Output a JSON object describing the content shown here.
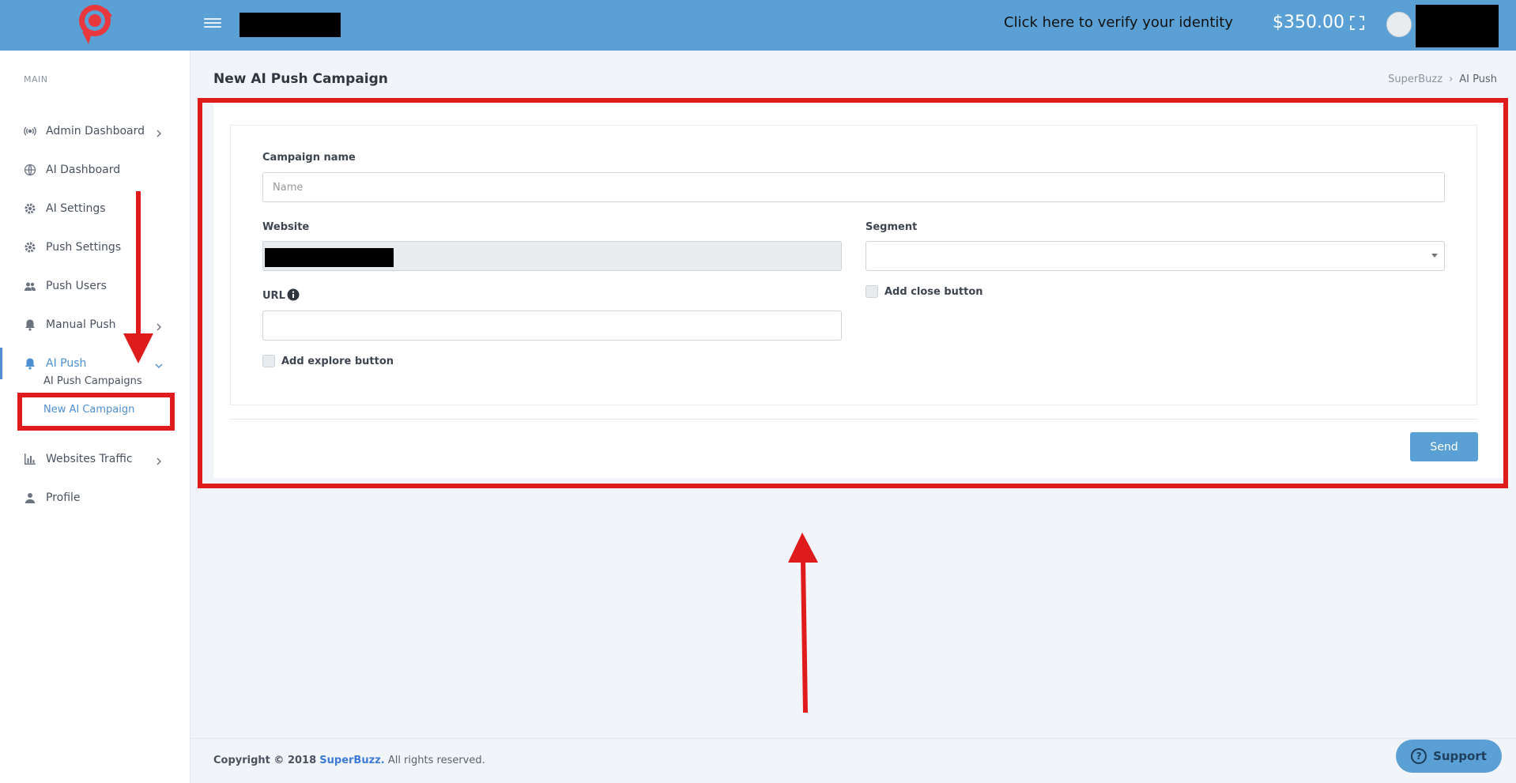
{
  "topbar": {
    "verify_text": "Click here to verify your identity",
    "balance": "$350.00",
    "icons": [
      "logo-icon",
      "hamburger-icon",
      "fullscreen-icon",
      "avatar"
    ]
  },
  "sidebar": {
    "section_title": "MAIN",
    "items": [
      {
        "label": "Admin Dashboard",
        "icon": "broadcast-icon",
        "has_chevron": true
      },
      {
        "label": "AI Dashboard",
        "icon": "globe-icon",
        "has_chevron": false
      },
      {
        "label": "AI Settings",
        "icon": "gear-icon",
        "has_chevron": false
      },
      {
        "label": "Push Settings",
        "icon": "gear-icon",
        "has_chevron": false
      },
      {
        "label": "Push Users",
        "icon": "users-icon",
        "has_chevron": false
      },
      {
        "label": "Manual Push",
        "icon": "bell-icon",
        "has_chevron": true
      },
      {
        "label": "AI Push",
        "icon": "bell-icon",
        "has_chevron": true,
        "active": true
      },
      {
        "label": "Websites Traffic",
        "icon": "bar-chart-icon",
        "has_chevron": true
      },
      {
        "label": "Profile",
        "icon": "user-icon",
        "has_chevron": false
      }
    ],
    "submenu": [
      {
        "label": "AI Push Campaigns"
      },
      {
        "label": "New AI Campaign",
        "current": true
      }
    ]
  },
  "page": {
    "title": "New AI Push Campaign",
    "breadcrumb": [
      "SuperBuzz",
      "AI Push"
    ]
  },
  "form": {
    "campaign_name_label": "Campaign name",
    "campaign_name_placeholder": "Name",
    "website_label": "Website",
    "segment_label": "Segment",
    "url_label": "URL",
    "add_close_button_label": "Add close button",
    "add_explore_button_label": "Add explore button",
    "send_label": "Send"
  },
  "footer": {
    "copyright_prefix": "Copyright © 2018",
    "brand": "SuperBuzz.",
    "suffix": "All rights reserved.",
    "support_label": "Support"
  },
  "colors": {
    "topbar": "#5aa0d4",
    "accent": "#4d8fd1",
    "annotation": "#e01b1b"
  }
}
